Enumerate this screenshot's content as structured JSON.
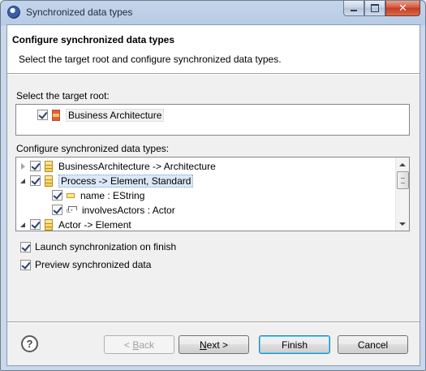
{
  "window": {
    "title": "Synchronized data types"
  },
  "header": {
    "title": "Configure synchronized data types",
    "description": "Select the target root and configure synchronized data types."
  },
  "target_root": {
    "label": "Select the target root:",
    "item": {
      "label": "Business Architecture",
      "checked": true,
      "icon": "package-icon"
    }
  },
  "types": {
    "label": "Configure synchronized data types:",
    "rows": [
      {
        "label": "BusinessArchitecture -> Architecture",
        "expanded": false,
        "checked": true,
        "icon": "class-icon"
      },
      {
        "label": "Process -> Element, Standard",
        "expanded": true,
        "checked": true,
        "icon": "class-icon",
        "selected": true
      },
      {
        "label": "name : EString",
        "checked": true,
        "icon": "attribute-icon"
      },
      {
        "label": "involvesActors : Actor",
        "checked": true,
        "icon": "reference-icon"
      },
      {
        "label": "Actor -> Element",
        "expanded": true,
        "checked": true,
        "icon": "class-icon"
      }
    ]
  },
  "options": {
    "launch_sync": {
      "label": "Launch synchronization on finish",
      "checked": true
    },
    "preview": {
      "label": "Preview synchronized data",
      "checked": true
    }
  },
  "buttons": {
    "back_prefix": "< ",
    "back_mnemonic": "B",
    "back_rest": "ack",
    "next_mnemonic": "N",
    "next_rest": "ext >",
    "finish": "Finish",
    "cancel": "Cancel"
  }
}
